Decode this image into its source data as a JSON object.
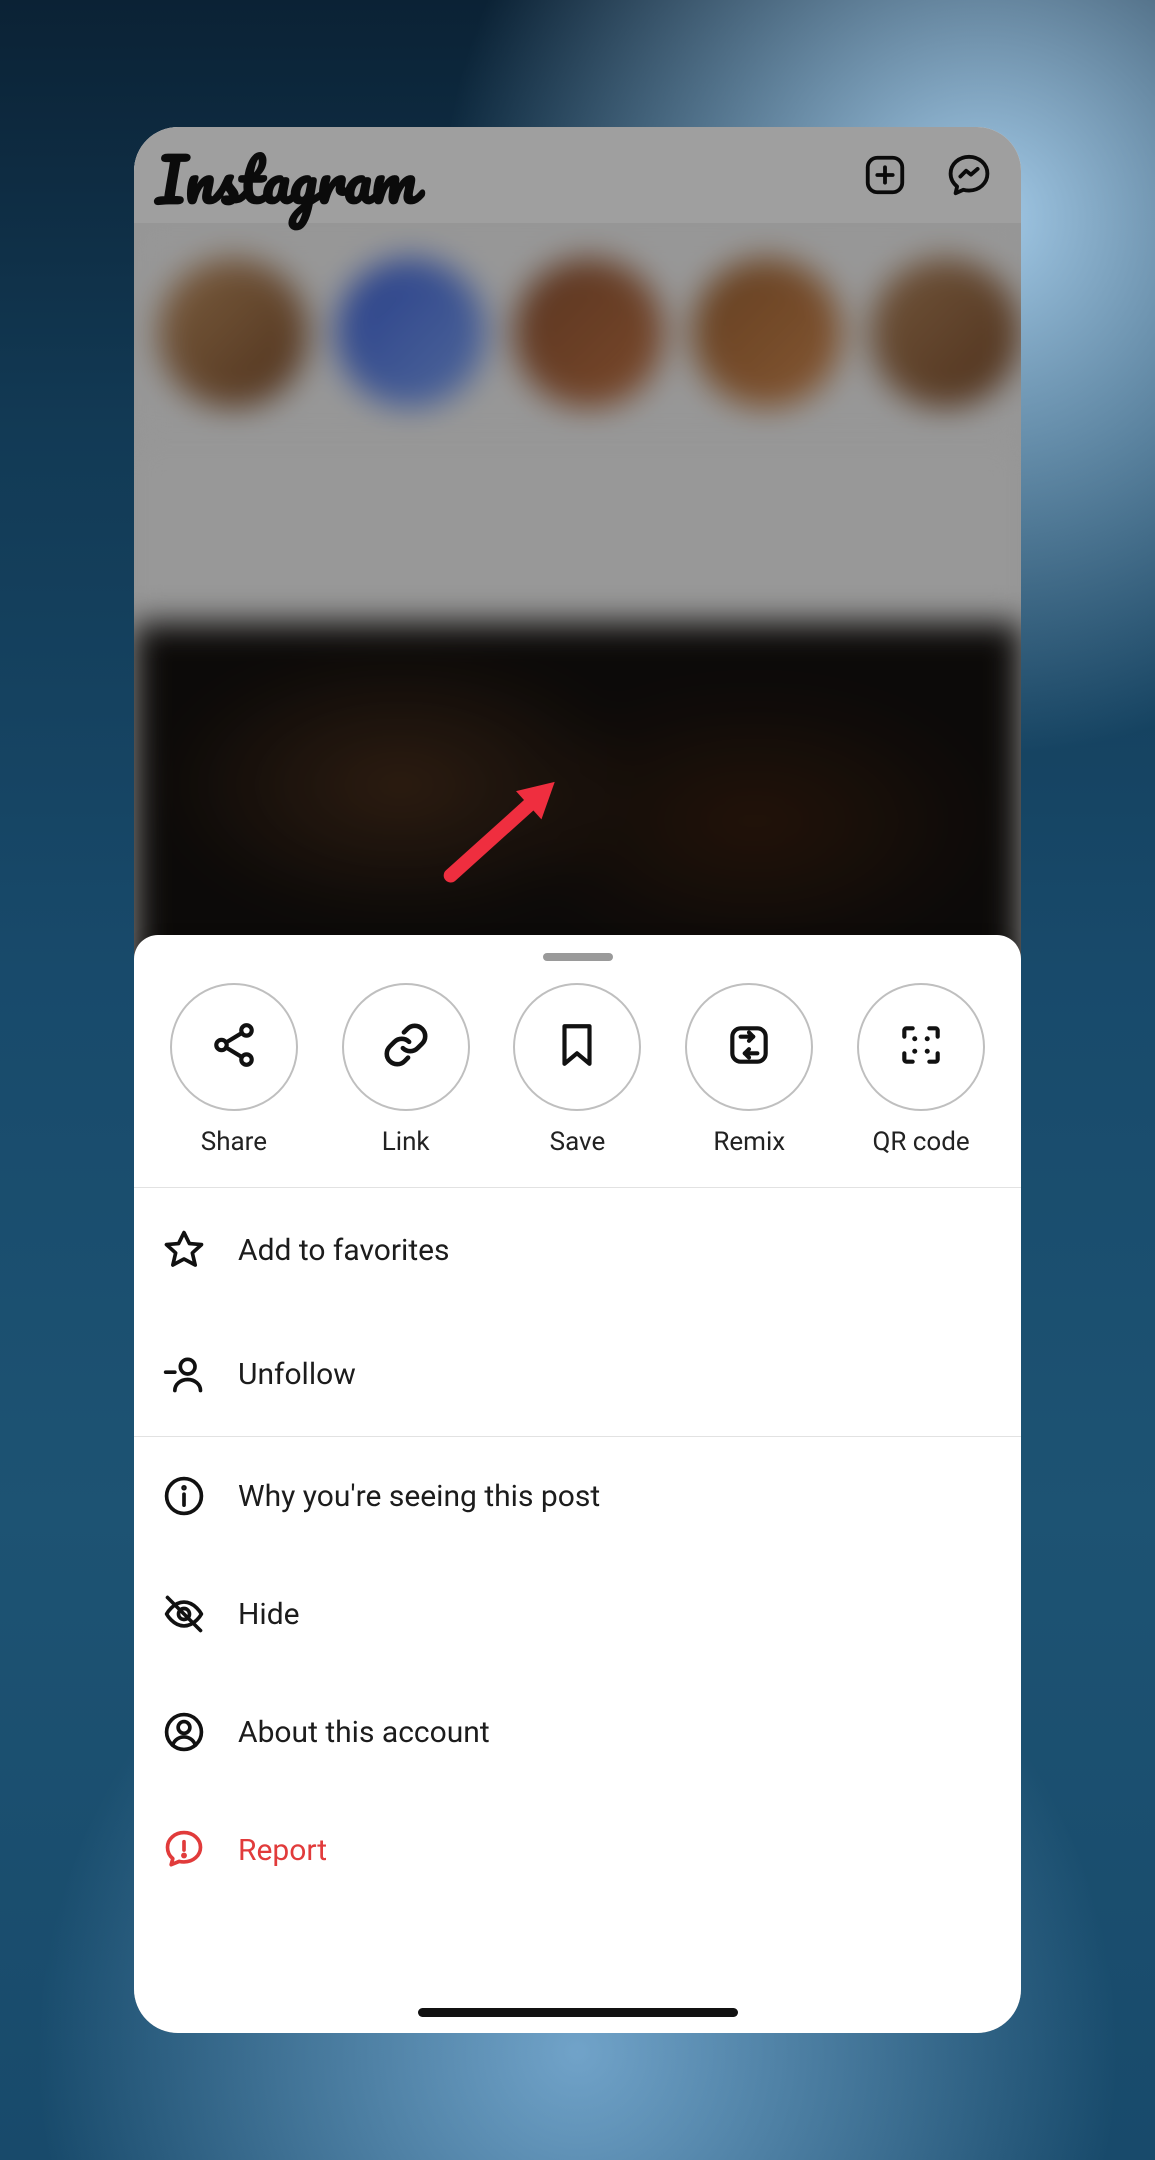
{
  "app_name": "Instagram",
  "sheet_actions": {
    "share": {
      "label": "Share"
    },
    "link": {
      "label": "Link"
    },
    "save": {
      "label": "Save"
    },
    "remix": {
      "label": "Remix"
    },
    "qr": {
      "label": "QR code"
    }
  },
  "sheet_menu": {
    "favorites": {
      "label": "Add to favorites"
    },
    "unfollow": {
      "label": "Unfollow"
    },
    "why": {
      "label": "Why you're seeing this post"
    },
    "hide": {
      "label": "Hide"
    },
    "about": {
      "label": "About this account"
    },
    "report": {
      "label": "Report"
    }
  },
  "colors": {
    "report": "#e13b3b"
  },
  "annotation": {
    "points_to": "save-button"
  }
}
